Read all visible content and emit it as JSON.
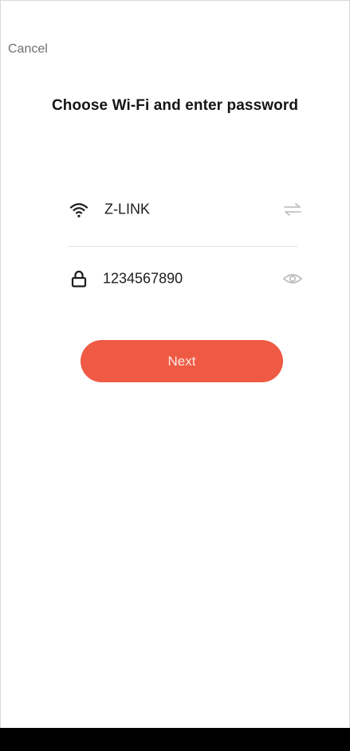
{
  "header": {
    "cancel_label": "Cancel",
    "title": "Choose Wi-Fi and enter password"
  },
  "wifi": {
    "network_name": "Z-LINK",
    "icon": "wifi-icon",
    "switch_icon": "swap-arrows-icon"
  },
  "password": {
    "value": "1234567890",
    "icon": "lock-icon",
    "toggle_icon": "eye-icon"
  },
  "actions": {
    "next_label": "Next"
  },
  "colors": {
    "accent": "#ef5a45",
    "button_text": "#ffe9e3",
    "muted_icon": "#b8b8b8",
    "divider": "#e3e3e3"
  }
}
